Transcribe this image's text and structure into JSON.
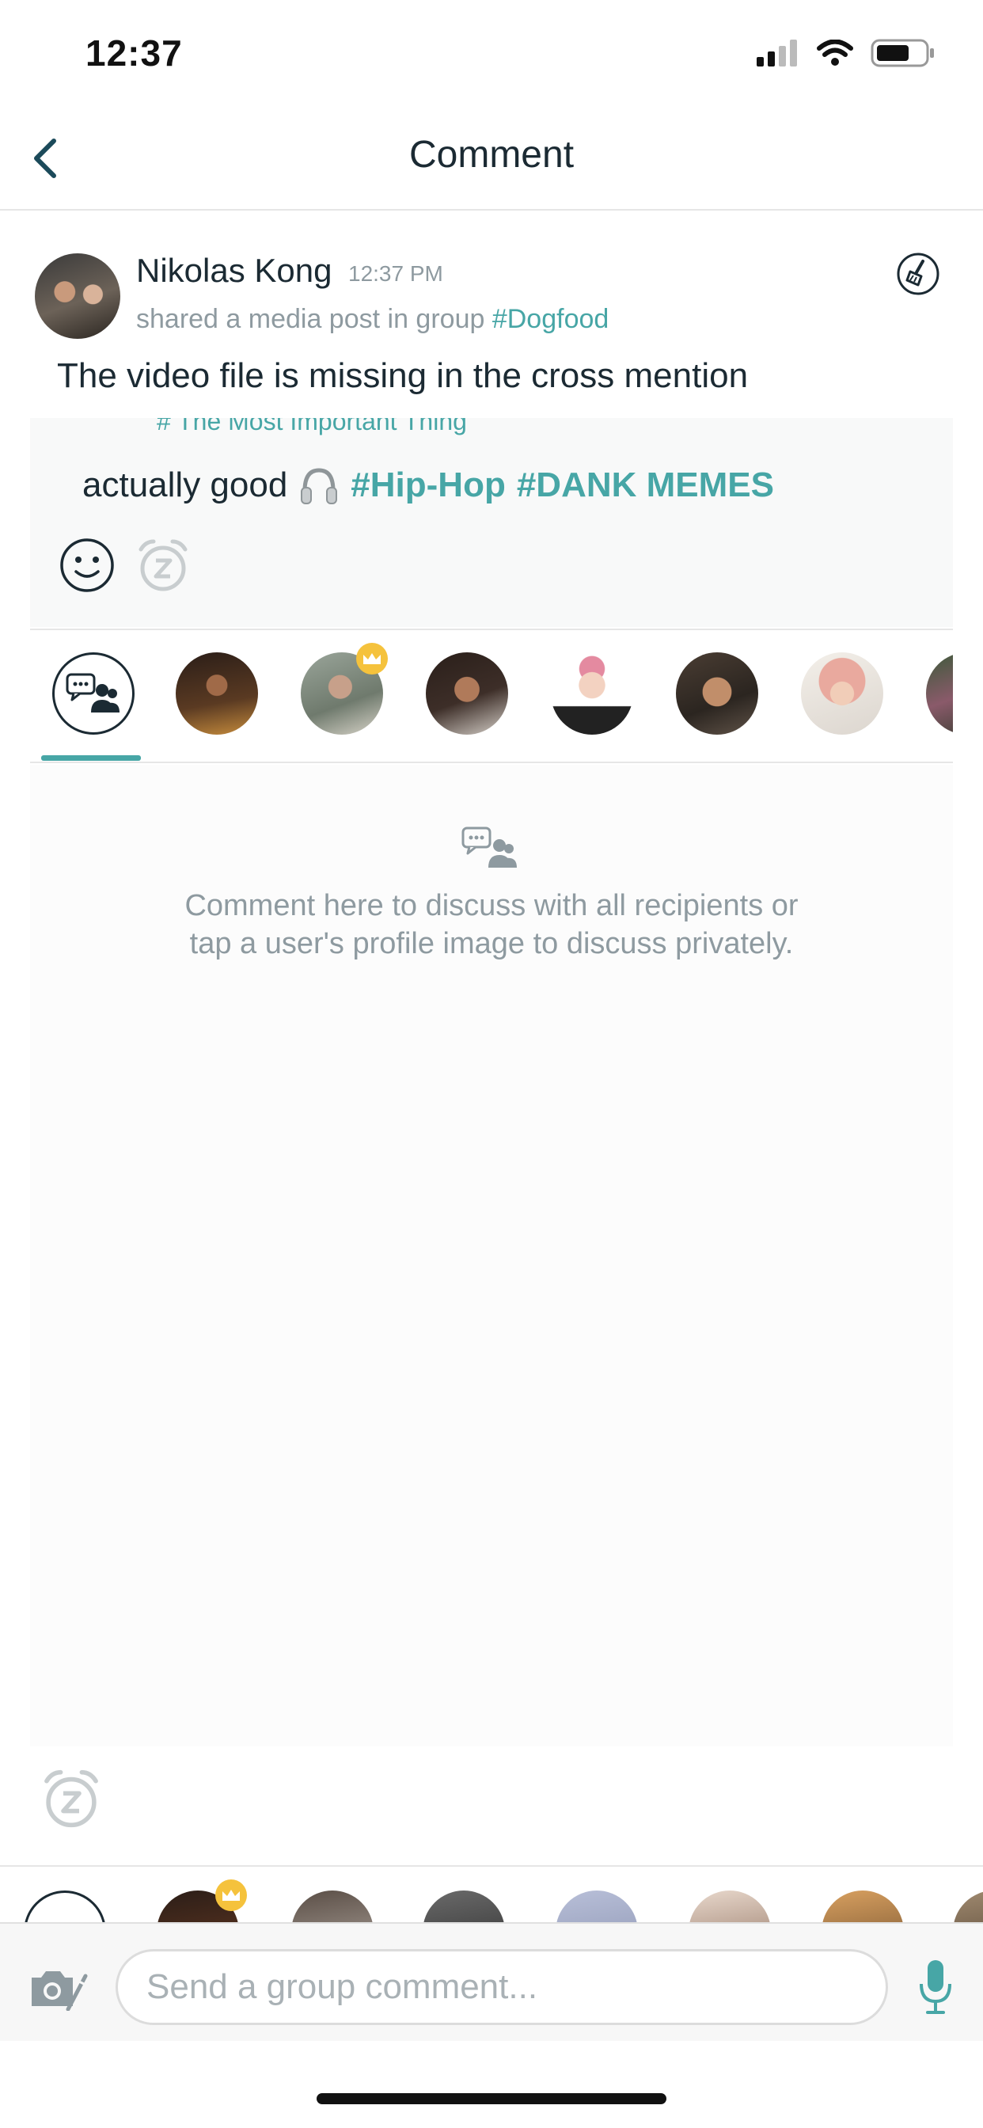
{
  "status_bar": {
    "time": "12:37"
  },
  "nav": {
    "title": "Comment"
  },
  "post": {
    "author_name": "Nikolas Kong",
    "time": "12:37 PM",
    "meta_prefix": "shared a media post in group",
    "group": "#Dogfood",
    "text": "The video file is missing in the cross mention",
    "media": {
      "clipped_title": "# The Most Important Thing",
      "caption_text": "actually good",
      "tags": [
        "#Hip-Hop",
        "#DANK MEMES"
      ]
    }
  },
  "recipients": {
    "items": [
      {
        "name": "all-recipients",
        "selected": true
      },
      {
        "name": "recipient-1"
      },
      {
        "name": "recipient-2",
        "crown": true
      },
      {
        "name": "recipient-3"
      },
      {
        "name": "recipient-4"
      },
      {
        "name": "recipient-5"
      },
      {
        "name": "recipient-6"
      },
      {
        "name": "recipient-7"
      }
    ]
  },
  "comments": {
    "empty_line1": "Comment here to discuss with all recipients or",
    "empty_line2": "tap a user's profile image to discuss privately."
  },
  "composer": {
    "placeholder": "Send a group comment..."
  },
  "colors": {
    "accent": "#47a6a6",
    "text": "#1b2a33",
    "muted": "#8e9aa0",
    "crown": "#f5c23c"
  }
}
